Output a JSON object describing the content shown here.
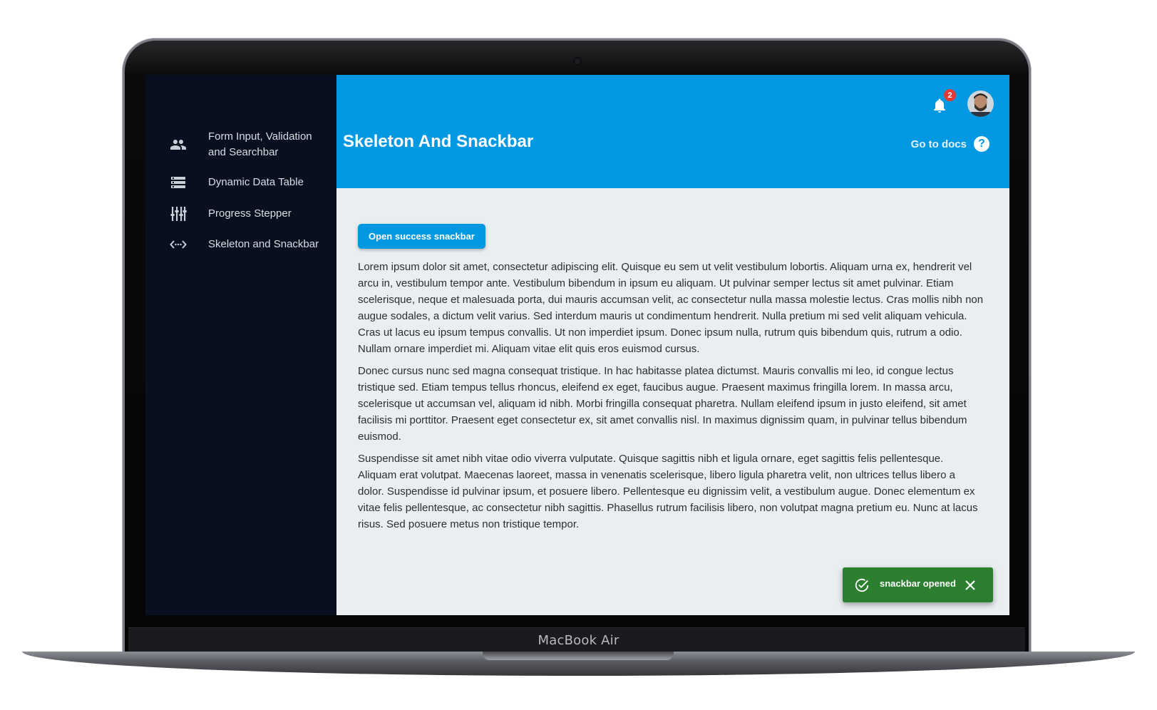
{
  "device": {
    "brand": "MacBook Air"
  },
  "sidebar": {
    "items": [
      {
        "label": "Form Input, Validation and Searchbar",
        "icon": "people-icon"
      },
      {
        "label": "Dynamic Data Table",
        "icon": "storage-icon"
      },
      {
        "label": "Progress Stepper",
        "icon": "tune-icon"
      },
      {
        "label": "Skeleton and Snackbar",
        "icon": "code-icon"
      }
    ]
  },
  "header": {
    "title": "Skeleton And Snackbar",
    "docs_label": "Go to docs",
    "help_glyph": "?",
    "notification_count": "2",
    "accent": "#0398e2"
  },
  "main": {
    "button_label": "Open success snackbar",
    "paragraphs": [
      "Lorem ipsum dolor sit amet, consectetur adipiscing elit. Quisque eu sem ut velit vestibulum lobortis. Aliquam urna ex, hendrerit vel arcu in, vestibulum tempor ante. Vestibulum bibendum in ipsum eu aliquam. Ut pulvinar semper lectus sit amet pulvinar. Etiam scelerisque, neque et malesuada porta, dui mauris accumsan velit, ac consectetur nulla massa molestie lectus. Cras mollis nibh non augue sodales, a dictum velit varius. Sed interdum mauris ut condimentum hendrerit. Nulla pretium mi sed velit aliquam vehicula. Cras ut lacus eu ipsum tempus convallis. Ut non imperdiet ipsum. Donec ipsum nulla, rutrum quis bibendum quis, rutrum a odio. Nullam ornare imperdiet mi. Aliquam vitae elit quis eros euismod cursus.",
      "Donec cursus nunc sed magna consequat tristique. In hac habitasse platea dictumst. Mauris convallis mi leo, id congue lectus tristique sed. Etiam tempus tellus rhoncus, eleifend ex eget, faucibus augue. Praesent maximus fringilla lorem. In massa arcu, scelerisque ut accumsan vel, aliquam id nibh. Morbi fringilla consequat pharetra. Nullam eleifend ipsum in justo eleifend, sit amet facilisis mi porttitor. Praesent eget consectetur ex, sit amet convallis nisl. In maximus dignissim quam, in pulvinar tellus bibendum euismod.",
      "Suspendisse sit amet nibh vitae odio viverra vulputate. Quisque sagittis nibh et ligula ornare, eget sagittis felis pellentesque. Aliquam erat volutpat. Maecenas laoreet, massa in venenatis scelerisque, libero ligula pharetra velit, non ultrices tellus libero a dolor. Suspendisse id pulvinar ipsum, et posuere libero. Pellentesque eu dignissim velit, a vestibulum augue. Donec elementum ex vitae felis pellentesque, ac consectetur nibh sagittis. Phasellus rutrum facilisis libero, non volutpat magna pretium eu. Nunc at lacus risus. Sed posuere metus non tristique tempor."
    ]
  },
  "snackbar": {
    "message": "snackbar opened",
    "color": "#2b7f2f"
  }
}
